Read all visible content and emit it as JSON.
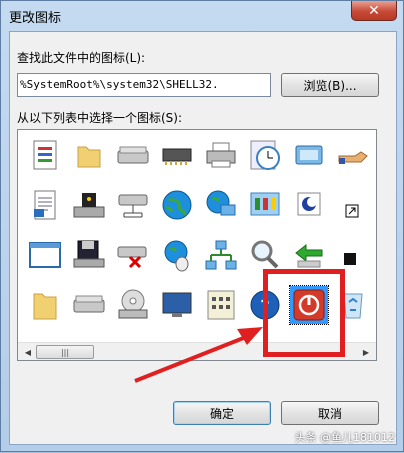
{
  "window": {
    "title": "更改图标",
    "close_glyph": "✕"
  },
  "form": {
    "find_label": "查找此文件中的图标(L):",
    "path_value": "%SystemRoot%\\system32\\SHELL32.",
    "browse_label": "浏览(B)...",
    "list_label": "从以下列表中选择一个图标(S):"
  },
  "icons": [
    {
      "name": "document-list-icon"
    },
    {
      "name": "folder-icon"
    },
    {
      "name": "hard-drive-icon"
    },
    {
      "name": "memory-chip-icon"
    },
    {
      "name": "printer-icon"
    },
    {
      "name": "clock-icon"
    },
    {
      "name": "display-settings-icon"
    },
    {
      "name": "hand-share-icon"
    },
    {
      "name": "text-document-icon"
    },
    {
      "name": "locked-drive-icon"
    },
    {
      "name": "network-drive-icon"
    },
    {
      "name": "globe-icon"
    },
    {
      "name": "network-globe-icon"
    },
    {
      "name": "control-panel-icon"
    },
    {
      "name": "moon-settings-icon"
    },
    {
      "name": "shortcut-arrow-icon"
    },
    {
      "name": "window-icon"
    },
    {
      "name": "floppy-disk-icon"
    },
    {
      "name": "disconnected-drive-icon"
    },
    {
      "name": "globe-mouse-icon"
    },
    {
      "name": "network-icon"
    },
    {
      "name": "search-icon"
    },
    {
      "name": "green-arrow-icon"
    },
    {
      "name": "black-square-icon"
    },
    {
      "name": "open-folder-icon"
    },
    {
      "name": "drive-icon"
    },
    {
      "name": "cd-drive-icon"
    },
    {
      "name": "computer-monitor-icon"
    },
    {
      "name": "calculator-icon"
    },
    {
      "name": "help-icon"
    },
    {
      "name": "power-icon"
    },
    {
      "name": "recycle-bin-icon"
    }
  ],
  "buttons": {
    "ok_label": "确定",
    "cancel_label": "取消"
  },
  "scrollbar": {
    "left_arrow": "◀",
    "right_arrow": "▶",
    "grip": "|||"
  },
  "watermark": "头条 @鱼儿181012",
  "colors": {
    "selection": "#3399ff",
    "highlight": "#e02020"
  }
}
